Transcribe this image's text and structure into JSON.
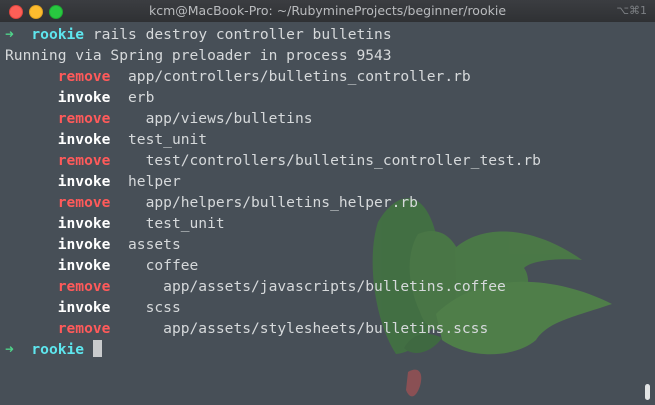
{
  "window": {
    "title": "kcm@MacBook-Pro: ~/RubymineProjects/beginner/rookie",
    "shortcut": "⌥⌘1"
  },
  "prompt": {
    "arrow": "➜",
    "dir": "rookie"
  },
  "command": "rails destroy controller bulletins",
  "spring_line": "Running via Spring preloader in process 9543",
  "actions": [
    {
      "action": "remove",
      "path": "app/controllers/bulletins_controller.rb"
    },
    {
      "action": "invoke",
      "path": "erb"
    },
    {
      "action": "remove",
      "path": "  app/views/bulletins"
    },
    {
      "action": "invoke",
      "path": "test_unit"
    },
    {
      "action": "remove",
      "path": "  test/controllers/bulletins_controller_test.rb"
    },
    {
      "action": "invoke",
      "path": "helper"
    },
    {
      "action": "remove",
      "path": "  app/helpers/bulletins_helper.rb"
    },
    {
      "action": "invoke",
      "path": "  test_unit"
    },
    {
      "action": "invoke",
      "path": "assets"
    },
    {
      "action": "invoke",
      "path": "  coffee"
    },
    {
      "action": "remove",
      "path": "    app/assets/javascripts/bulletins.coffee"
    },
    {
      "action": "invoke",
      "path": "  scss"
    },
    {
      "action": "remove",
      "path": "    app/assets/stylesheets/bulletins.scss"
    }
  ],
  "colors": {
    "remove": "#ff5a5a",
    "invoke": "#ffffff",
    "prompt_arrow": "#4fd28a",
    "prompt_dir": "#5ee6ee",
    "background": "#474f57"
  },
  "icons": {
    "watermark": "rubymine-leaf-watermark-icon"
  }
}
